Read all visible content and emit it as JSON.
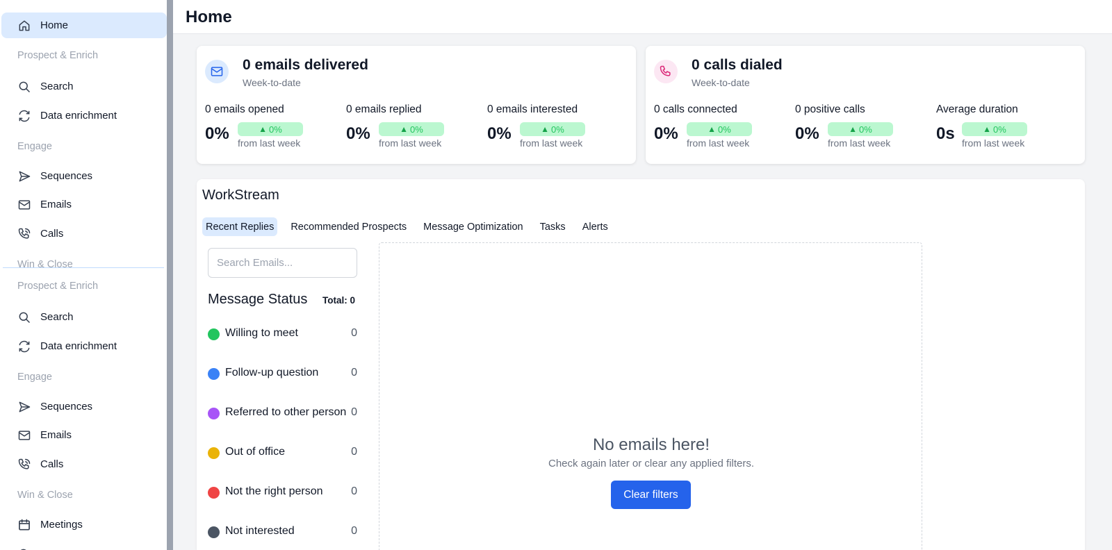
{
  "sidebar": {
    "top": {
      "home": "Home",
      "group_prospect": "Prospect & Enrich",
      "search": "Search",
      "data_enrichment": "Data enrichment",
      "group_engage": "Engage",
      "sequences": "Sequences",
      "emails": "Emails",
      "calls": "Calls",
      "group_win": "Win & Close"
    },
    "bottom": {
      "group_prospect": "Prospect & Enrich",
      "search": "Search",
      "data_enrichment": "Data enrichment",
      "group_engage": "Engage",
      "sequences": "Sequences",
      "emails": "Emails",
      "calls": "Calls",
      "group_win": "Win & Close",
      "meetings": "Meetings"
    }
  },
  "header": {
    "title": "Home"
  },
  "email_card": {
    "title": "0 emails delivered",
    "subtitle": "Week-to-date",
    "icon": "mail-icon",
    "accent": "#2563eb",
    "metrics": [
      {
        "label": "0 emails opened",
        "value": "0%",
        "change": "0%",
        "from": "from last week"
      },
      {
        "label": "0 emails replied",
        "value": "0%",
        "change": "0%",
        "from": "from last week"
      },
      {
        "label": "0 emails interested",
        "value": "0%",
        "change": "0%",
        "from": "from last week"
      }
    ]
  },
  "calls_card": {
    "title": "0 calls dialed",
    "subtitle": "Week-to-date",
    "icon": "phone-icon",
    "accent": "#db2777",
    "metrics": [
      {
        "label": "0 calls connected",
        "value": "0%",
        "change": "0%",
        "from": "from last week"
      },
      {
        "label": "0 positive calls",
        "value": "0%",
        "change": "0%",
        "from": "from last week"
      },
      {
        "label": "Average duration",
        "value": "0s",
        "change": "0%",
        "from": "from last week"
      }
    ]
  },
  "workstream": {
    "title": "WorkStream",
    "tabs": [
      "Recent Replies",
      "Recommended Prospects",
      "Message Optimization",
      "Tasks",
      "Alerts"
    ],
    "active_tab": "Recent Replies",
    "search_placeholder": "Search Emails...",
    "message_status": {
      "title": "Message Status",
      "total": "Total: 0",
      "items": [
        {
          "label": "Willing to meet",
          "count": "0",
          "color": "#22c55e"
        },
        {
          "label": "Follow-up question",
          "count": "0",
          "color": "#3b82f6"
        },
        {
          "label": "Referred to other person",
          "count": "0",
          "color": "#a855f7"
        },
        {
          "label": "Out of office",
          "count": "0",
          "color": "#eab308"
        },
        {
          "label": "Not the right person",
          "count": "0",
          "color": "#ef4444"
        },
        {
          "label": "Not interested",
          "count": "0",
          "color": "#4b5563"
        }
      ]
    },
    "empty": {
      "title": "No emails here!",
      "subtitle": "Check again later or clear any applied filters.",
      "button": "Clear filters"
    }
  }
}
